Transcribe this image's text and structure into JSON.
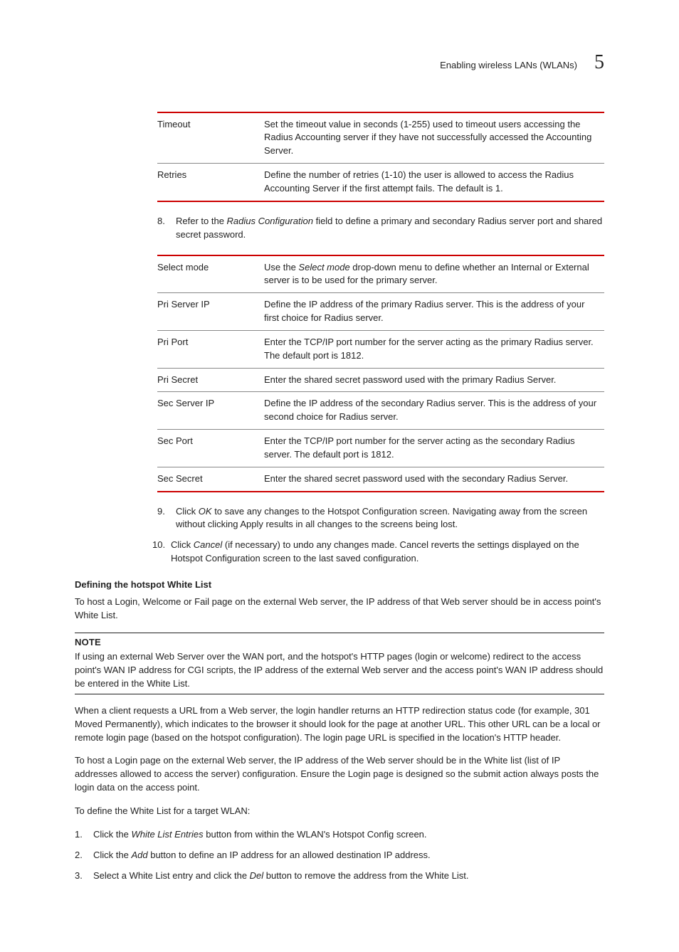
{
  "header": {
    "title": "Enabling wireless LANs (WLANs)",
    "chapter": "5"
  },
  "table1": {
    "rows": [
      {
        "k": "Timeout",
        "v": "Set the timeout value in seconds (1-255) used to timeout users accessing the Radius Accounting server if they have not successfully accessed the Accounting Server."
      },
      {
        "k": "Retries",
        "v": "Define the number of retries (1-10) the user is allowed to access the Radius Accounting Server if the first attempt fails. The default is 1."
      }
    ]
  },
  "step8": {
    "num": "8.",
    "pre": "Refer to the ",
    "em": "Radius Configuration",
    "post": " field to define a primary and secondary Radius server port and shared secret password."
  },
  "table2": {
    "row0": {
      "k": "Select mode",
      "pre": "Use the ",
      "em": "Select mode",
      "post": " drop-down menu to define whether an Internal or External server is to be used for the primary server."
    },
    "rows": [
      {
        "k": "Pri Server IP",
        "v": "Define the IP address of the primary Radius server. This is the address of your first choice for Radius server."
      },
      {
        "k": "Pri Port",
        "v": "Enter the TCP/IP port number for the server acting as the primary Radius server. The default port is 1812."
      },
      {
        "k": "Pri Secret",
        "v": "Enter the shared secret password used with the primary Radius Server."
      },
      {
        "k": "Sec Server IP",
        "v": "Define the IP address of the secondary Radius server. This is the address of your second choice for Radius server."
      },
      {
        "k": "Sec Port",
        "v": "Enter the TCP/IP port number for the server acting as the secondary Radius server. The default port is 1812."
      },
      {
        "k": "Sec Secret",
        "v": "Enter the shared secret password used with the secondary Radius Server."
      }
    ]
  },
  "step9": {
    "num": "9.",
    "pre": "Click ",
    "em": "OK",
    "post": " to save any changes to the Hotspot Configuration screen. Navigating away from the screen without clicking Apply results in all changes to the screens being lost."
  },
  "step10": {
    "num": "10.",
    "pre": "Click ",
    "em": "Cancel",
    "post": " (if necessary) to undo any changes made. Cancel reverts the settings displayed on the Hotspot Configuration screen to the last saved configuration."
  },
  "whitelist": {
    "heading": "Defining the hotspot White List",
    "intro": "To host a Login, Welcome or Fail page on the external Web server, the IP address of that Web server should be in access point's White List.",
    "noteLabel": "NOTE",
    "noteBody": "If using an external Web Server over the WAN port, and the hotspot's HTTP pages (login or welcome) redirect to the access point's WAN IP address for CGI scripts, the IP address of the external Web server and the access point's WAN IP address should be entered in the White List.",
    "p1": "When a client requests a URL from a Web server, the login handler returns an HTTP redirection status code (for example, 301 Moved Permanently), which indicates to the browser it should look for the page at another URL. This other URL can be a local or remote login page (based on the hotspot configuration). The login page URL is specified in the location's HTTP header.",
    "p2": "To host a Login page on the external Web server, the IP address of the Web server should be in the White list (list of IP addresses allowed to access the server) configuration. Ensure the Login page is designed so the submit action always posts the login data on the access point.",
    "p3": "To define the White List for a target WLAN:",
    "s1": {
      "num": "1.",
      "pre": "Click the ",
      "em": "White List Entries",
      "post": " button from within the WLAN's Hotspot Config screen."
    },
    "s2": {
      "num": "2.",
      "pre": "Click the ",
      "em": "Add",
      "post": " button to define an IP address for an allowed destination IP address."
    },
    "s3": {
      "num": "3.",
      "pre": "Select a White List entry and click the ",
      "em": "Del",
      "post": " button to remove the address from the White List."
    }
  }
}
